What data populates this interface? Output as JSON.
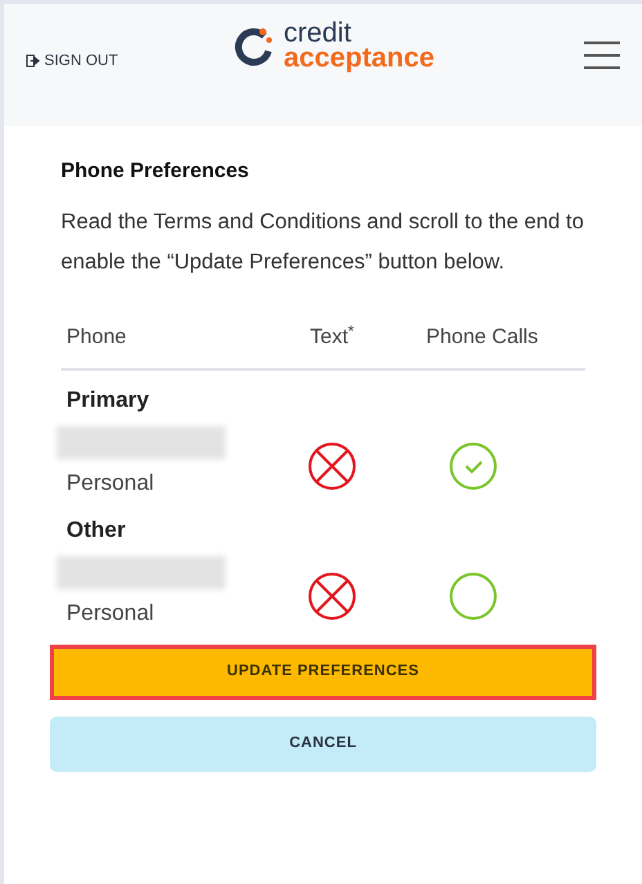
{
  "header": {
    "sign_out": "SIGN OUT",
    "logo_top": "credit",
    "logo_bottom": "acceptance"
  },
  "section": {
    "title": "Phone Preferences",
    "description": "Read the Terms and Conditions and scroll to the end to enable the “Update Preferences” button below."
  },
  "table": {
    "columns": [
      "Phone",
      "Text$^{*}$",
      "Phone Calls"
    ],
    "groups": [
      {
        "label": "Primary",
        "phones": [
          {
            "type": "Personal",
            "text_opt_in": false,
            "calls_opt_in": true
          }
        ]
      },
      {
        "label": "Other",
        "phones": [
          {
            "type": "Personal",
            "text_opt_in": false,
            "calls_opt_in": false
          }
        ]
      }
    ]
  },
  "buttons": [
    {
      "kind": "primary",
      "label": "UPDATE PREFERENCES",
      "highlighted": true
    },
    {
      "kind": "secondary",
      "label": "CANCEL",
      "highlighted": false
    }
  ]
}
